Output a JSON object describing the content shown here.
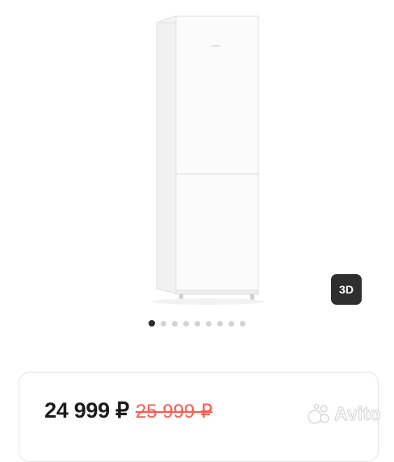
{
  "gallery": {
    "image_alt": "Холодильник",
    "badge_3d": "3D",
    "slide_count": 9,
    "active_slide": 1
  },
  "price": {
    "current": "24 999 ₽",
    "old": "25 999 ₽",
    "old_color": "#ff5a4f"
  },
  "watermark": {
    "brand": "Avito"
  }
}
